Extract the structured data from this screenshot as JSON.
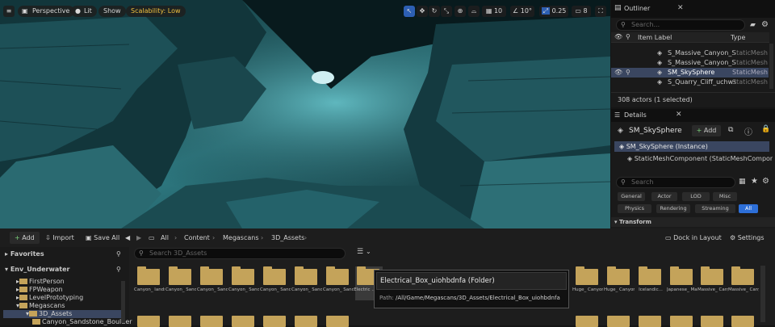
{
  "viewport": {
    "menu_icon": "hamburger-icon",
    "perspective_label": "Perspective",
    "lit_label": "Lit",
    "show_label": "Show",
    "scalability_label": "Scalability: Low",
    "grid_value": "10",
    "angle_value": "10°",
    "scale_value": "0.25",
    "camera_speed_value": "8",
    "colors": {
      "scalability_text": "#f0c040",
      "accent": "#3a7bd5"
    }
  },
  "outliner": {
    "title": "Outliner",
    "search_placeholder": "Search...",
    "col_label": "Item Label",
    "col_type": "Type",
    "rows": [
      {
        "label": "S_Massive_Canyon_S",
        "type": "StaticMesh"
      },
      {
        "label": "S_Massive_Canyon_S",
        "type": "StaticMesh"
      },
      {
        "label": "SM_SkySphere",
        "type": "StaticMesh"
      },
      {
        "label": "S_Quarry_Cliff_uchws",
        "type": "StaticMesh"
      }
    ],
    "status": "308 actors (1 selected)"
  },
  "details": {
    "title": "Details",
    "actor_name": "SM_SkySphere",
    "add_label": "Add",
    "instance_label": "SM_SkySphere (Instance)",
    "component_label": "StaticMeshComponent (StaticMeshComponent",
    "search_placeholder": "Search",
    "filters_row1": [
      "General",
      "Actor",
      "LOD",
      "Misc"
    ],
    "filters_row2": [
      "Physics",
      "Rendering",
      "Streaming",
      "All"
    ],
    "section": "Transform"
  },
  "content_browser": {
    "add_label": "Add",
    "import_label": "Import",
    "save_all_label": "Save All",
    "breadcrumb": [
      "All",
      "Content",
      "Megascans",
      "3D_Assets"
    ],
    "dock_label": "Dock in Layout",
    "settings_label": "Settings",
    "favorites_label": "Favorites",
    "project_label": "Env_Underwater",
    "search_placeholder": "Search 3D_Assets",
    "tree": [
      "FirstPerson",
      "FPWeapon",
      "LevelPrototyping",
      "Megascans",
      "3D_Assets",
      "Canyon_Sandstone_Boulder"
    ],
    "folders": [
      {
        "label": "Canyon_ landstone"
      },
      {
        "label": "Canyon_ Sandstone"
      },
      {
        "label": "Canyon_ Sandstone"
      },
      {
        "label": "Canyon_ Sandstone"
      },
      {
        "label": "Canyon_ Sandstone"
      },
      {
        "label": "Canyon_ Sandstone"
      },
      {
        "label": "Canyon_ Sandstone"
      },
      {
        "label": "Electric ...Box"
      },
      {
        "label": "Huge_ Canyon..."
      },
      {
        "label": "Huge_ Canyon..."
      },
      {
        "label": "Icelandic..."
      },
      {
        "label": "Japanese_ Marble..."
      },
      {
        "label": "Massive_ Canyon..."
      },
      {
        "label": "Massive_ Canyon..."
      }
    ],
    "tooltip": {
      "title": "Electrical_Box_uiohbdnfa",
      "kind": "(Folder)",
      "path_label": "Path:",
      "path": "/All/Game/Megascans/3D_Assets/Electrical_Box_uiohbdnfa"
    }
  }
}
